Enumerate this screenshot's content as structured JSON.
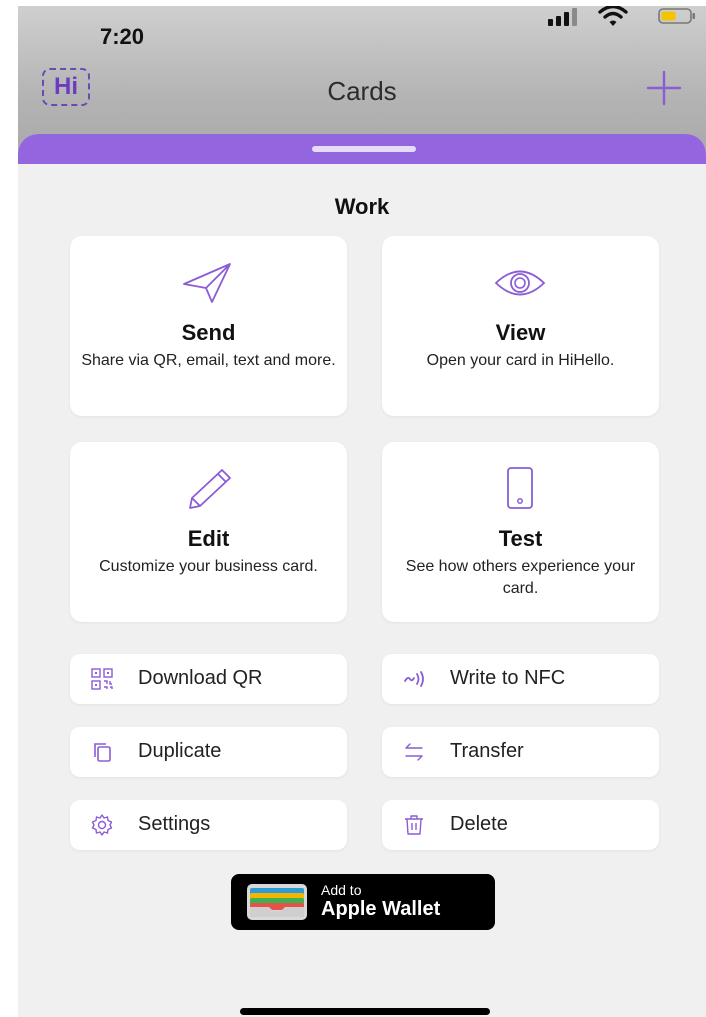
{
  "status_bar": {
    "time": "7:20"
  },
  "header": {
    "logo_text": "Hi",
    "title": "Cards",
    "add_icon": "plus-icon"
  },
  "section": {
    "title": "Work"
  },
  "tiles": [
    {
      "title": "Send",
      "description": "Share via QR, email, text and more.",
      "icon": "paper-plane-icon"
    },
    {
      "title": "View",
      "description": "Open your card in HiHello.",
      "icon": "eye-icon"
    },
    {
      "title": "Edit",
      "description": "Customize your business card.",
      "icon": "pencil-icon"
    },
    {
      "title": "Test",
      "description": "See how others experience your card.",
      "icon": "phone-icon"
    }
  ],
  "actions": [
    {
      "label": "Download QR",
      "icon": "qr-code-icon"
    },
    {
      "label": "Write to NFC",
      "icon": "nfc-icon"
    },
    {
      "label": "Duplicate",
      "icon": "duplicate-icon"
    },
    {
      "label": "Transfer",
      "icon": "transfer-icon"
    },
    {
      "label": "Settings",
      "icon": "gear-icon"
    },
    {
      "label": "Delete",
      "icon": "trash-icon"
    }
  ],
  "wallet": {
    "line1": "Add to",
    "line2": "Apple Wallet"
  },
  "colors": {
    "accent": "#9365df",
    "icon_purple": "#8a5cd6",
    "battery_yellow": "#f5c400",
    "background": "#f0f0f0"
  }
}
